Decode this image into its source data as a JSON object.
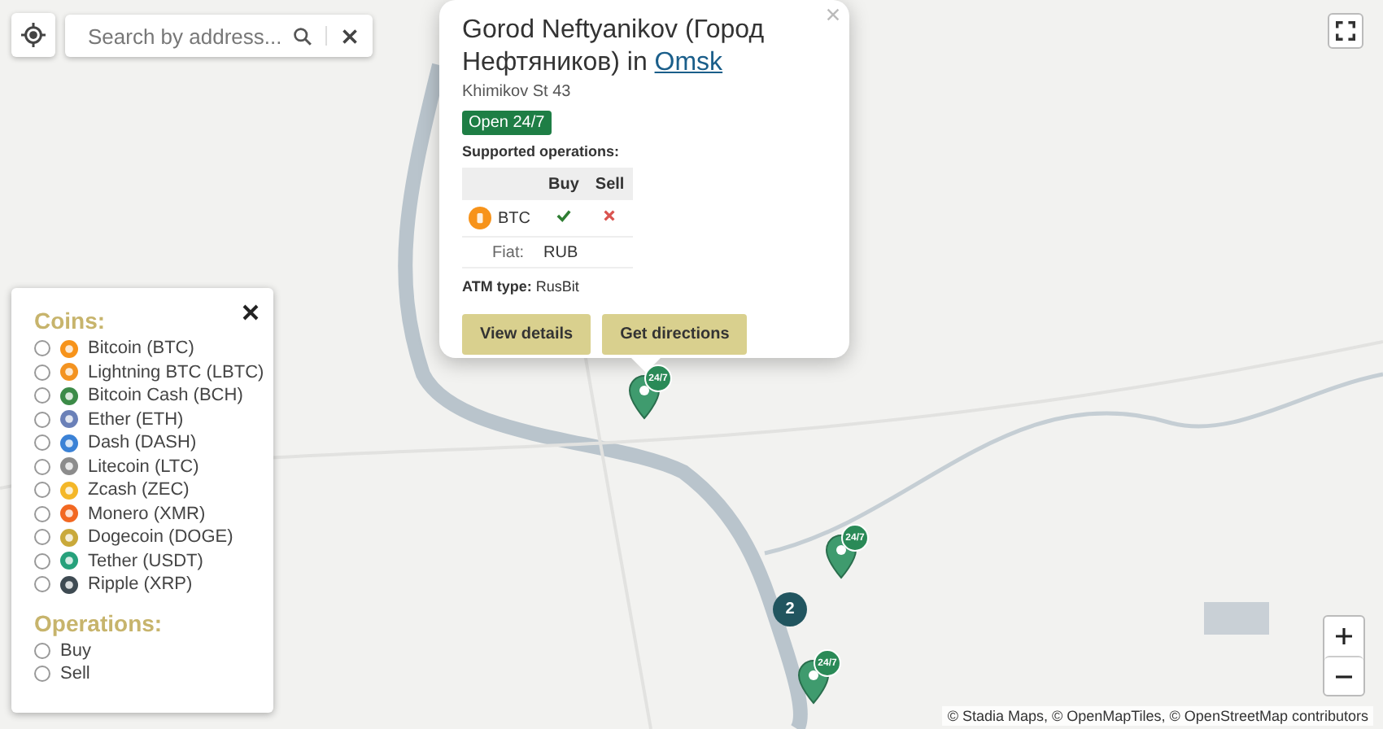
{
  "search": {
    "placeholder": "Search by address..."
  },
  "popup": {
    "title": "Gorod Neftyanikov (Город Нефтяников) in ",
    "city_link": "Omsk",
    "address": "Khimikov St 43",
    "status": "Open 24/7",
    "operations_heading": "Supported operations:",
    "columns": [
      "Buy",
      "Sell"
    ],
    "rows": [
      {
        "coin": "BTC",
        "color": "#f7931a",
        "buy": true,
        "sell": false
      }
    ],
    "fiat_label": "Fiat:",
    "fiat_value": "RUB",
    "atm_type": "**ATM type:** RusBit",
    "buttons": [
      "View details",
      "Get directions"
    ]
  },
  "filters": {
    "coins_heading": "Coins:",
    "coins": [
      {
        "name": "Bitcoin (BTC)",
        "color": "#f7931a",
        "selected": false
      },
      {
        "name": "Lightning BTC (LBTC)",
        "color": "#f39321",
        "selected": false
      },
      {
        "name": "Bitcoin Cash (BCH)",
        "color": "#3c8b48",
        "selected": false
      },
      {
        "name": "Ether (ETH)",
        "color": "#6a80b8",
        "selected": false
      },
      {
        "name": "Dash (DASH)",
        "color": "#3b82d6",
        "selected": false
      },
      {
        "name": "Litecoin (LTC)",
        "color": "#8c8c8c",
        "selected": false
      },
      {
        "name": "Zcash (ZEC)",
        "color": "#f4b728",
        "selected": false
      },
      {
        "name": "Monero (XMR)",
        "color": "#f26822",
        "selected": false
      },
      {
        "name": "Dogecoin (DOGE)",
        "color": "#c9a93a",
        "selected": false
      },
      {
        "name": "Tether (USDT)",
        "color": "#26a17b",
        "selected": false
      },
      {
        "name": "Ripple (XRP)",
        "color": "#3e4a52",
        "selected": false
      }
    ],
    "operations_heading": "Operations:",
    "operations": [
      {
        "name": "Buy",
        "selected": false
      },
      {
        "name": "Sell",
        "selected": false
      }
    ]
  },
  "markers": [
    {
      "kind": "atm",
      "badge": "24/7"
    },
    {
      "kind": "atm",
      "badge": "24/7"
    },
    {
      "kind": "cluster",
      "count": "2"
    },
    {
      "kind": "atm",
      "badge": "24/7"
    }
  ],
  "attribution": "© Stadia Maps, © OpenMapTiles, © OpenStreetMap contributors"
}
